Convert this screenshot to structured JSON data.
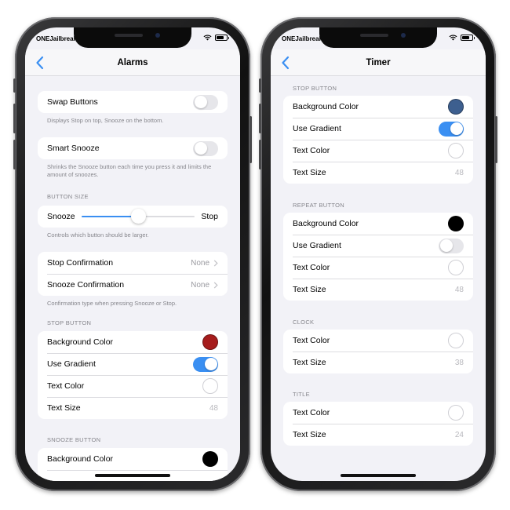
{
  "status": {
    "carrier": "ONEJailbreak"
  },
  "left": {
    "title": "Alarms",
    "swap_buttons": {
      "label": "Swap Buttons",
      "enabled": false,
      "footer": "Displays Stop on top, Snooze on the bottom."
    },
    "smart_snooze": {
      "label": "Smart Snooze",
      "enabled": false,
      "footer": "Shrinks the Snooze button each time you press it and limits the amount of snoozes."
    },
    "button_size": {
      "header": "BUTTON SIZE",
      "min_label": "Snooze",
      "max_label": "Stop",
      "value": 0.5,
      "footer": "Controls which button should be larger."
    },
    "confirmation": {
      "stop_label": "Stop Confirmation",
      "stop_value": "None",
      "snooze_label": "Snooze Confirmation",
      "snooze_value": "None",
      "footer": "Confirmation type when pressing Snooze or Stop."
    },
    "stop_button": {
      "header": "STOP BUTTON",
      "bg_label": "Background Color",
      "bg_color": "#a61c1c",
      "gradient_label": "Use Gradient",
      "gradient": true,
      "text_color_label": "Text Color",
      "text_color": "#ffffff",
      "text_size_label": "Text Size",
      "text_size": "48"
    },
    "snooze_button": {
      "header": "SNOOZE BUTTON",
      "bg_label": "Background Color",
      "bg_color": "#000000"
    }
  },
  "right": {
    "title": "Timer",
    "stop_button": {
      "header": "STOP BUTTON",
      "bg_label": "Background Color",
      "bg_color": "#3d5f8f",
      "gradient_label": "Use Gradient",
      "gradient": true,
      "text_color_label": "Text Color",
      "text_color": "#ffffff",
      "text_size_label": "Text Size",
      "text_size": "48"
    },
    "repeat_button": {
      "header": "REPEAT BUTTON",
      "bg_label": "Background Color",
      "bg_color": "#000000",
      "gradient_label": "Use Gradient",
      "gradient": false,
      "text_color_label": "Text Color",
      "text_color": "#ffffff",
      "text_size_label": "Text Size",
      "text_size": "48"
    },
    "clock": {
      "header": "CLOCK",
      "text_color_label": "Text Color",
      "text_color": "#ffffff",
      "text_size_label": "Text Size",
      "text_size": "38"
    },
    "title_section": {
      "header": "TITLE",
      "text_color_label": "Text Color",
      "text_color": "#ffffff",
      "text_size_label": "Text Size",
      "text_size": "24"
    }
  },
  "colors": {
    "accent": "#3a8ff2",
    "background": "#f2f2f7"
  },
  "icons": {
    "back": "chevron-left-icon",
    "disclosure": "chevron-right-icon",
    "wifi": "wifi-icon",
    "battery": "battery-icon"
  }
}
